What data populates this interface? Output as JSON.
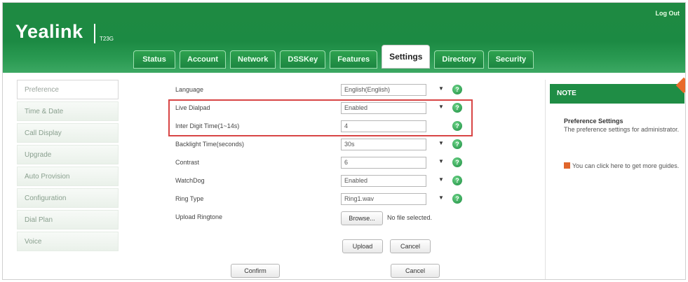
{
  "header": {
    "logo": "Yealink",
    "model": "T23G",
    "logout": "Log Out",
    "tabs": [
      "Status",
      "Account",
      "Network",
      "DSSKey",
      "Features",
      "Settings",
      "Directory",
      "Security"
    ],
    "active_tab": "Settings"
  },
  "sidebar": {
    "items": [
      "Preference",
      "Time & Date",
      "Call Display",
      "Upgrade",
      "Auto Provision",
      "Configuration",
      "Dial Plan",
      "Voice"
    ]
  },
  "form": {
    "rows": [
      {
        "label": "Language",
        "value": "English(English)",
        "type": "select"
      },
      {
        "label": "Live Dialpad",
        "value": "Enabled",
        "type": "select"
      },
      {
        "label": "Inter Digit Time(1~14s)",
        "value": "4",
        "type": "input"
      },
      {
        "label": "Backlight Time(seconds)",
        "value": "30s",
        "type": "select"
      },
      {
        "label": "Contrast",
        "value": "6",
        "type": "select"
      },
      {
        "label": "WatchDog",
        "value": "Enabled",
        "type": "select"
      },
      {
        "label": "Ring Type",
        "value": "Ring1.wav",
        "type": "select"
      }
    ],
    "upload_ringtone": {
      "label": "Upload Ringtone",
      "browse": "Browse...",
      "no_file": "No file selected.",
      "upload": "Upload",
      "cancel": "Cancel"
    },
    "help_glyph": "?",
    "confirm": "Confirm",
    "cancel": "Cancel"
  },
  "note": {
    "header": "NOTE",
    "title": "Preference Settings",
    "text": "The preference settings for administrator.",
    "link": "You can click here to get more guides."
  },
  "colors": {
    "header_green": "#1f8a42",
    "highlight_red": "#d84545",
    "note_orange": "#e96a2a"
  }
}
